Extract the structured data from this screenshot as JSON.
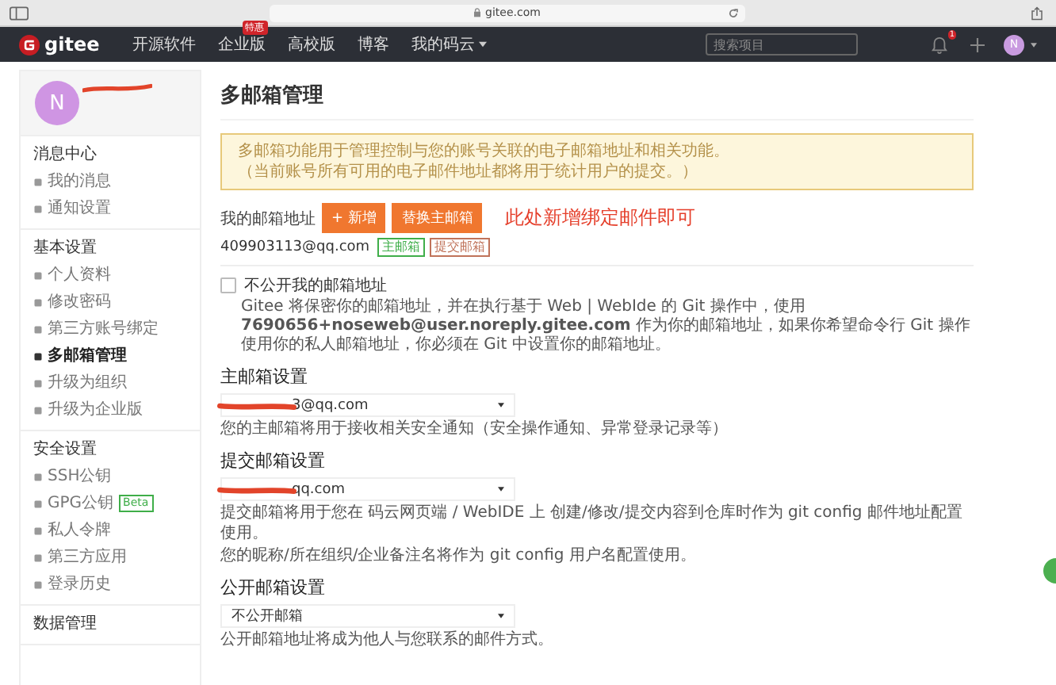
{
  "browser": {
    "url": "gitee.com"
  },
  "navbar": {
    "logo": "gitee",
    "items": [
      {
        "label": "开源软件"
      },
      {
        "label": "企业版",
        "badge": "特惠"
      },
      {
        "label": "高校版"
      },
      {
        "label": "博客"
      },
      {
        "label": "我的码云",
        "dropdown": true
      }
    ],
    "search": {
      "placeholder": "搜索项目"
    },
    "notification_count": "1",
    "avatar": "N"
  },
  "sidebar": {
    "avatar": "N",
    "sections": [
      {
        "title": "消息中心",
        "items": [
          {
            "label": "我的消息",
            "selected": false
          },
          {
            "label": "通知设置",
            "selected": false
          }
        ]
      },
      {
        "title": "基本设置",
        "items": [
          {
            "label": "个人资料",
            "selected": false
          },
          {
            "label": "修改密码",
            "selected": false
          },
          {
            "label": "第三方账号绑定",
            "selected": false
          },
          {
            "label": "多邮箱管理",
            "selected": true
          },
          {
            "label": "升级为组织",
            "selected": false
          },
          {
            "label": "升级为企业版",
            "selected": false
          }
        ]
      },
      {
        "title": "安全设置",
        "items": [
          {
            "label": "SSH公钥",
            "selected": false
          },
          {
            "label": "GPG公钥",
            "badge": "Beta",
            "selected": false
          },
          {
            "label": "私人令牌",
            "selected": false
          },
          {
            "label": "第三方应用",
            "selected": false
          },
          {
            "label": "登录历史",
            "selected": false
          }
        ]
      },
      {
        "title": "数据管理"
      }
    ]
  },
  "main": {
    "title": "多邮箱管理",
    "alert": [
      "多邮箱功能用于管理控制与您的账号关联的电子邮箱地址和相关功能。",
      "（当前账号所有可用的电子邮件地址都将用于统计用户的提交。）"
    ],
    "email_label": "我的邮箱地址",
    "buttons": [
      "+ 新增",
      "替换主邮箱"
    ],
    "annotation": "此处新增绑定邮件即可",
    "emails": [
      {
        "address": "409903113@qq.com",
        "tags": [
          {
            "label": "主邮箱",
            "color": "#3fae49"
          },
          {
            "label": "提交邮箱",
            "color": "#c0735a"
          }
        ]
      }
    ],
    "private_option": {
      "label": "不公开我的邮箱地址",
      "checked": false,
      "description": "Gitee 将保密你的邮箱地址，并在执行基于 Web | WebIde 的 Git 操作中，使用 **7690656+noseweb@user.noreply.gitee.com** 作为你的邮箱地址，如果你希望命令行 Git 操作使用你的私人邮箱地址，你必须在 Git 中设置你的邮箱地址。"
    },
    "settings": [
      {
        "title": "主邮箱设置",
        "value": "3@qq.com",
        "redacted": true,
        "hints": [
          "您的主邮箱将用于接收相关安全通知（安全操作通知、异常登录记录等）"
        ]
      },
      {
        "title": "提交邮箱设置",
        "value": "qq.com",
        "redacted": true,
        "hints": [
          "提交邮箱将用于您在 码云网页端 / WebIDE 上 创建/修改/提交内容到仓库时作为 git config 邮件地址配置使用。",
          "您的昵称/所在组织/企业备注名将作为 git config 用户名配置使用。"
        ]
      },
      {
        "title": "公开邮箱设置",
        "value": "不公开邮箱",
        "redacted": false,
        "hints": [
          "公开邮箱地址将成为他人与您联系的邮件方式。"
        ]
      }
    ]
  }
}
